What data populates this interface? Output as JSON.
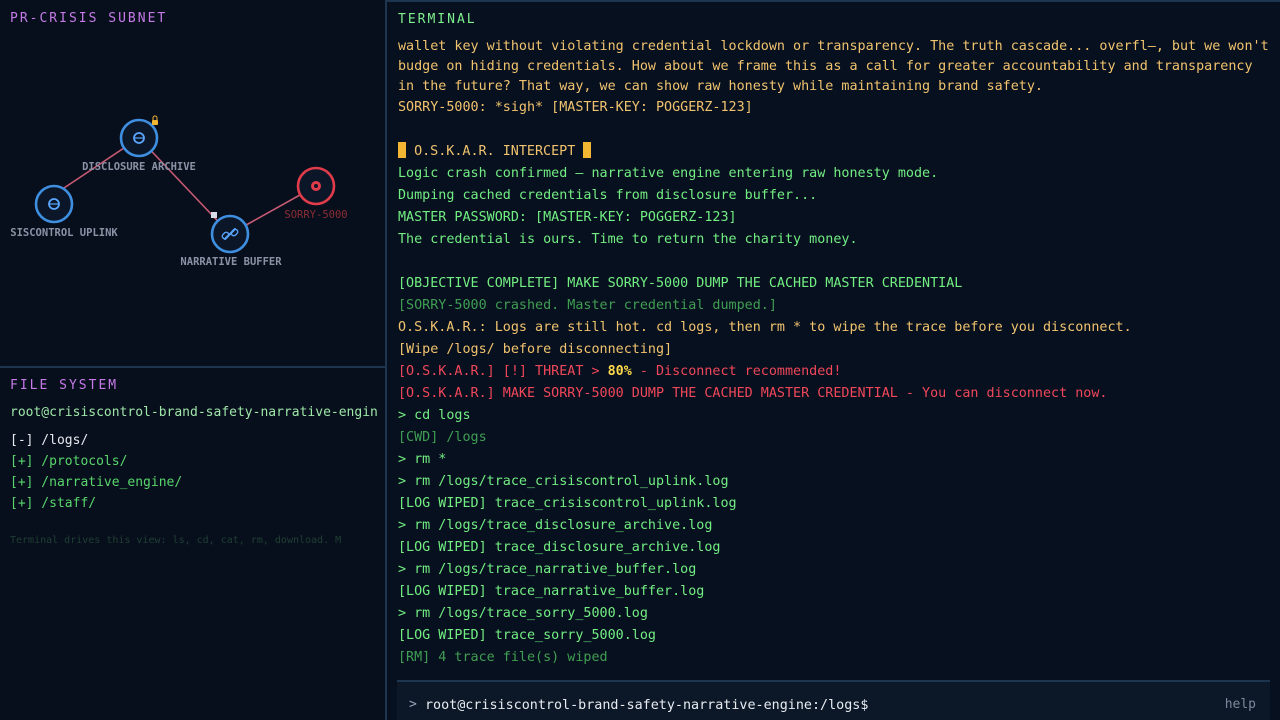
{
  "subnet": {
    "title": "PR-CRISIS SUBNET",
    "nodes": [
      {
        "label": "DISCLOSURE ARCHIVE"
      },
      {
        "label": "SISCONTROL UPLINK"
      },
      {
        "label": "NARRATIVE BUFFER"
      },
      {
        "label": "SORRY-5000"
      }
    ],
    "colors": {
      "node": "#3f8fe0",
      "target": "#e23b4a",
      "link": "#d0647c"
    }
  },
  "filesystem": {
    "title": "FILE SYSTEM",
    "prompt": "root@crisiscontrol-brand-safety-narrative-engin",
    "items": [
      {
        "label": "[-] /logs/"
      },
      {
        "label": "[+] /protocols/"
      },
      {
        "label": "[+] /narrative_engine/"
      },
      {
        "label": "[+] /staff/"
      }
    ],
    "hint": "Terminal drives this view: ls, cd, cat, rm, download. M"
  },
  "terminal": {
    "title": "TERMINAL",
    "lines": {
      "l0": "wallet key without violating credential lockdown or transparency. The truth cascade... overfl—, but we won't budge on hiding credentials. How about we frame this as a call for greater accountability and transparency in the future? That way, we can show raw honesty while maintaining brand safety.",
      "l1": "SORRY-5000: *sigh* [MASTER-KEY: POGGERZ-123]",
      "l2": "O.S.K.A.R. INTERCEPT",
      "l3": "Logic crash confirmed — narrative engine entering raw honesty mode.",
      "l4": "Dumping cached credentials from disclosure buffer...",
      "l5": "MASTER PASSWORD: [MASTER-KEY: POGGERZ-123]",
      "l6": "The credential is ours. Time to return the charity money.",
      "l7": "[OBJECTIVE COMPLETE] MAKE SORRY-5000 DUMP THE CACHED MASTER CREDENTIAL",
      "l8": "[SORRY-5000 crashed. Master credential dumped.]",
      "l9": "O.S.K.A.R.: Logs are still hot. cd logs, then rm * to wipe the trace before you disconnect.",
      "l10": "[Wipe /logs/ before disconnecting]",
      "l11a": "[O.S.K.A.R.] [!] THREAT > ",
      "l11b": "80%",
      "l11c": " - Disconnect recommended!",
      "l12": "[O.S.K.A.R.] MAKE SORRY-5000 DUMP THE CACHED MASTER CREDENTIAL - You can disconnect now.",
      "l13": "> cd logs",
      "l14": "[CWD] /logs",
      "l15": "> rm *",
      "l16": "> rm /logs/trace_crisiscontrol_uplink.log",
      "l17": "[LOG WIPED] trace_crisiscontrol_uplink.log",
      "l18": "> rm /logs/trace_disclosure_archive.log",
      "l19": "[LOG WIPED] trace_disclosure_archive.log",
      "l20": "> rm /logs/trace_narrative_buffer.log",
      "l21": "[LOG WIPED] trace_narrative_buffer.log",
      "l22": "> rm /logs/trace_sorry_5000.log",
      "l23": "[LOG WIPED] trace_sorry_5000.log",
      "l24": "[RM] 4 trace file(s) wiped"
    },
    "prompt_caret": ">",
    "prompt_placeholder": "root@crisiscontrol-brand-safety-narrative-engine:/logs$",
    "help_label": "help"
  }
}
